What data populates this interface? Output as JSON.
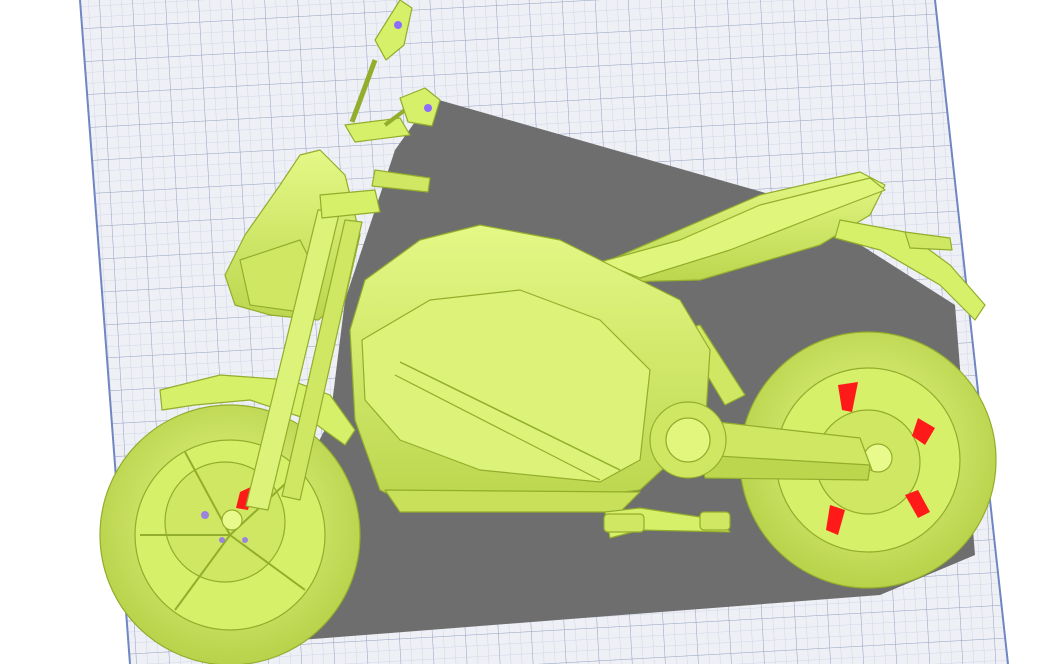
{
  "viewport": {
    "background": "#ffffff"
  },
  "build_plate": {
    "fill": "#eef0f6",
    "grid_minor_color": "#c9d0e2",
    "grid_major_color": "#9aa6c4",
    "edge_color": "#6f86c2"
  },
  "shadow": {
    "fill": "#6e6e6e"
  },
  "model": {
    "fill": "#d6f06a",
    "highlight": "#e8fa8c",
    "shade": "#a9c43a",
    "line": "#93ad2c",
    "overhang_color": "#ff1a1a",
    "artifact_color": "#8d6cff"
  }
}
